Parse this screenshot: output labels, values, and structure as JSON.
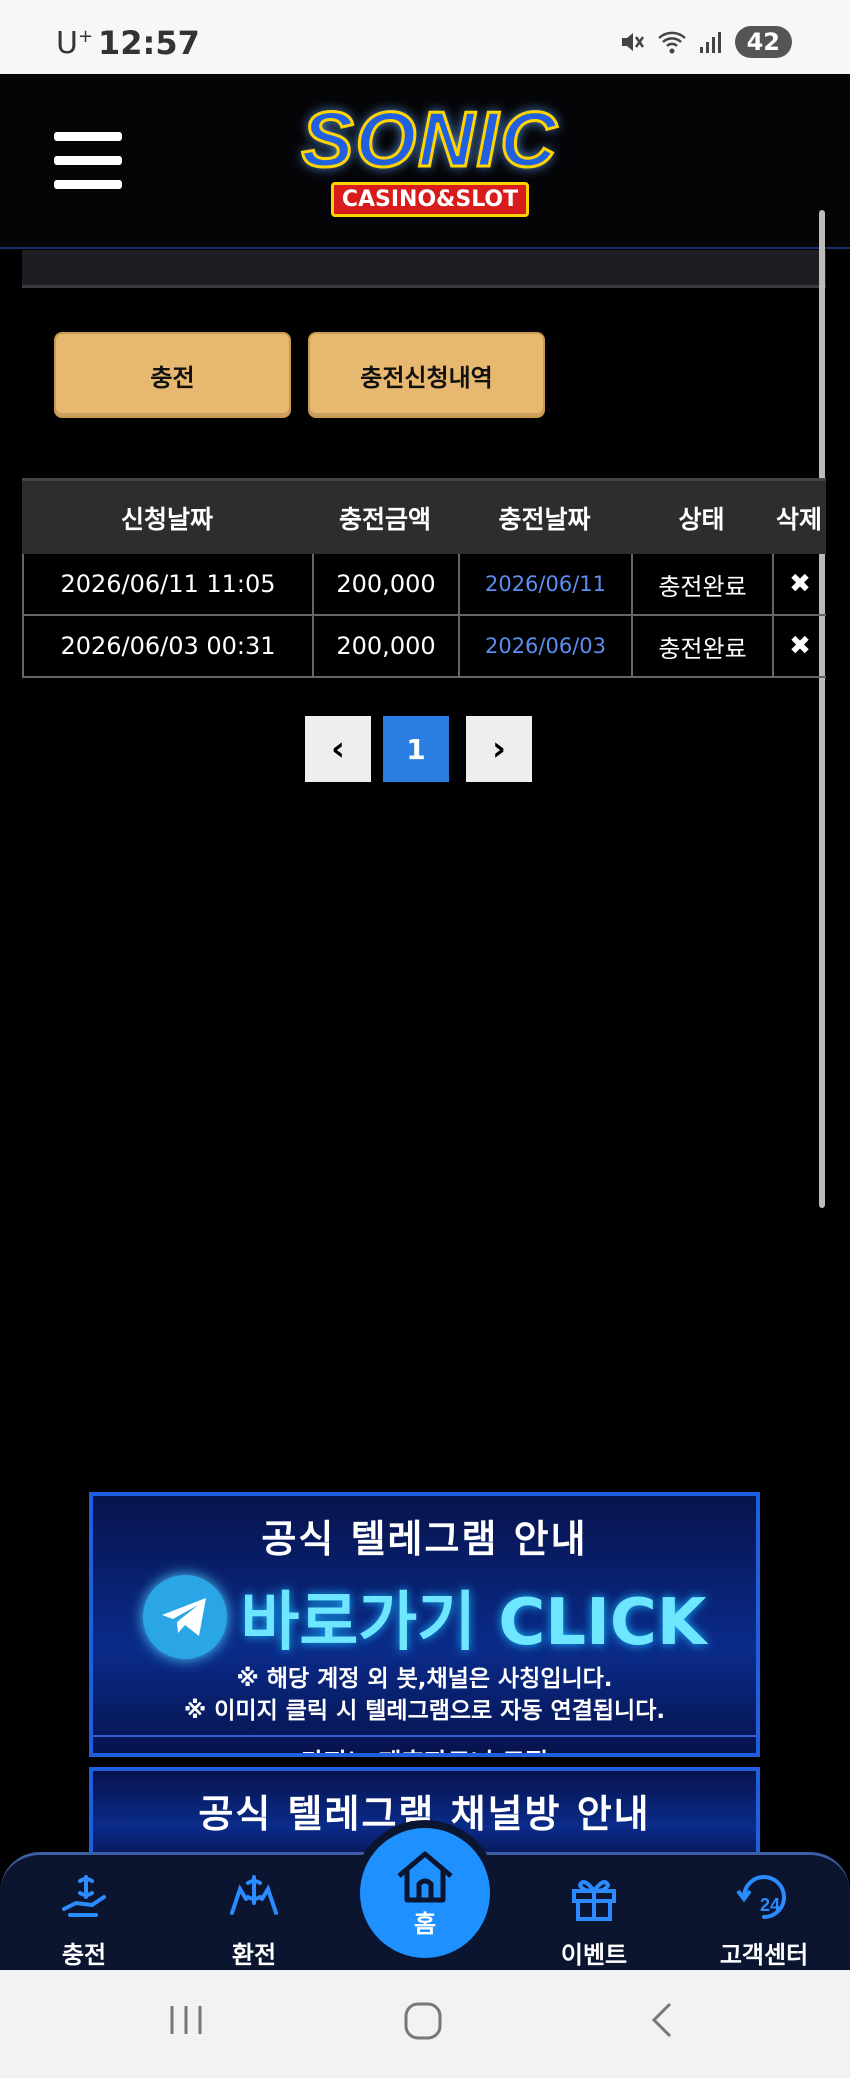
{
  "status_bar": {
    "carrier": "U",
    "carrier_sup": "+",
    "time": "12:57",
    "battery": "42"
  },
  "header": {
    "logo_main": "SONIC",
    "logo_sub": "CASINO&SLOT"
  },
  "buttons": {
    "charge": "충전",
    "charge_history": "충전신청내역"
  },
  "table": {
    "headers": [
      "신청날짜",
      "충전금액",
      "충전날짜",
      "상태",
      "삭제"
    ],
    "rows": [
      {
        "request_date": "2026/06/11 11:05",
        "amount": "200,000",
        "charge_date": "2026/06/11",
        "status": "충전완료",
        "delete": "✖"
      },
      {
        "request_date": "2026/06/03 00:31",
        "amount": "200,000",
        "charge_date": "2026/06/03",
        "status": "충전완료",
        "delete": "✖"
      }
    ]
  },
  "pagination": {
    "prev": "‹",
    "current": "1",
    "next": "›"
  },
  "banner1": {
    "title": "공식 텔레그램 안내",
    "click": "바로가기 CLICK",
    "note1": "※ 해당 계정 외 봇,채널은 사칭입니다.",
    "note2": "※ 이미지 클릭 시 텔레그램으로 자동 연결됩니다.",
    "footer": "카지노 제휴파트너 모집"
  },
  "banner2": {
    "title": "공식 텔레그램 채널방 안내"
  },
  "bottom_nav": {
    "charge": "충전",
    "exchange": "환전",
    "home": "홈",
    "event": "이벤트",
    "customer_center": "고객센터"
  },
  "colors": {
    "accent_gold": "#e7b86f",
    "accent_blue": "#1e90ff",
    "date_blue": "#5b8ef0"
  }
}
